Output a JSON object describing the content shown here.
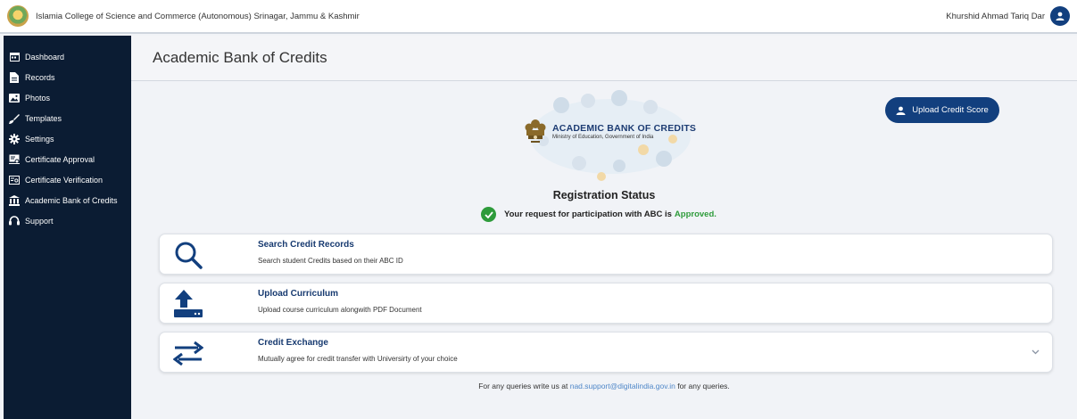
{
  "header": {
    "org_name": "Islamia College of Science and Commerce (Autonomous) Srinagar, Jammu & Kashmir",
    "user_name": "Khurshid Ahmad Tariq Dar"
  },
  "sidebar": {
    "items": [
      {
        "label": "Dashboard",
        "icon": "calendar-icon"
      },
      {
        "label": "Records",
        "icon": "file-icon"
      },
      {
        "label": "Photos",
        "icon": "photo-icon"
      },
      {
        "label": "Templates",
        "icon": "brush-icon"
      },
      {
        "label": "Settings",
        "icon": "gear-icon"
      },
      {
        "label": "Certificate Approval",
        "icon": "certificate-icon"
      },
      {
        "label": "Certificate Verification",
        "icon": "verify-icon"
      },
      {
        "label": "Academic Bank of Credits",
        "icon": "bank-icon"
      },
      {
        "label": "Support",
        "icon": "headset-icon"
      }
    ]
  },
  "page": {
    "title": "Academic Bank of Credits",
    "upload_button": "Upload Credit Score",
    "banner_title": "ACADEMIC BANK OF CREDITS",
    "banner_subtitle": "Ministry of Education, Government of India",
    "registration_title": "Registration Status",
    "status_prefix": "Your request for participation with ABC is",
    "status_value": "Approved."
  },
  "cards": [
    {
      "title": "Search Credit Records",
      "desc": "Search student Credits based on their ABC ID",
      "icon": "search-icon"
    },
    {
      "title": "Upload Curriculum",
      "desc": "Upload course curriculum alongwith PDF Document",
      "icon": "upload-icon"
    },
    {
      "title": "Credit Exchange",
      "desc": "Mutually agree for credit transfer with Universirty of your choice",
      "icon": "exchange-icon"
    }
  ],
  "footer": {
    "prefix": "For any queries write us at",
    "email": "nad.support@digitalindia.gov.in",
    "suffix": "for any queries."
  },
  "colors": {
    "sidebar_bg": "#0b1c33",
    "accent": "#123f7e",
    "approved": "#2e9b3b"
  }
}
